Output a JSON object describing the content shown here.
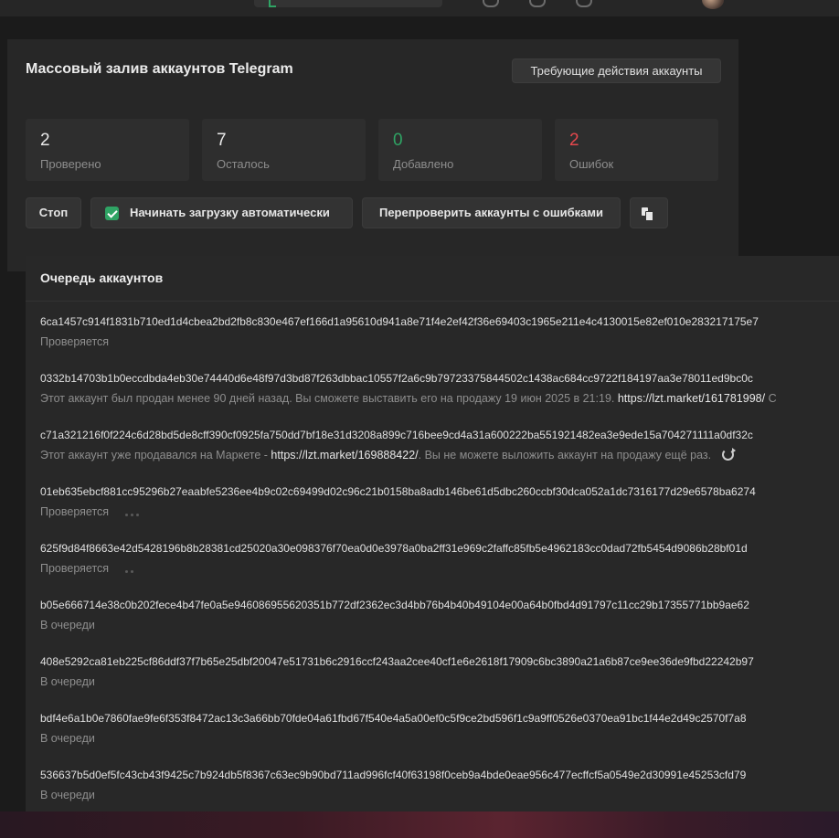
{
  "window": {
    "accent": "#2fa364",
    "error_color": "#e5484d"
  },
  "panel": {
    "title": "Массовый залив аккаунтов Telegram",
    "action_required_button": "Требующие действия аккаунты"
  },
  "stats": [
    {
      "value": "2",
      "label": "Проверено"
    },
    {
      "value": "7",
      "label": "Осталось"
    },
    {
      "value": "0",
      "label": "Добавлено"
    },
    {
      "value": "2",
      "label": "Ошибок"
    }
  ],
  "controls": {
    "stop": "Стоп",
    "auto_start": "Начинать загрузку автоматически",
    "auto_start_checked": true,
    "recheck": "Перепроверить аккаунты с ошибками",
    "copy_icon": "copy-icon"
  },
  "queue": {
    "title": "Очередь аккаунтов",
    "items": [
      {
        "hash": "6ca1457c914f1831b710ed1d4cbea2bd2fb8c830e467ef166d1a95610d941a8e71f4e2ef42f36e69403c1965e211e4c4130015e82ef010e283217175e7",
        "status": "Проверяется"
      },
      {
        "hash": "0332b14703b1b0eccdbda4eb30e74440d6e48f97d3bd87f263dbbac10557f2a6c9b79723375844502c1438ac684cc9722f184197aa3e78011ed9bc0c",
        "status": "Этот аккаунт был продан менее 90 дней назад. Вы сможете выставить его на продажу 19 июн 2025 в 21:19.",
        "link": "https://lzt.market/161781998/",
        "tail": "С"
      },
      {
        "hash": "c71a321216f0f224c6d28bd5de8cff390cf0925fa750dd7bf18e31d3208a899c716bee9cd4a31a600222ba551921482ea3e9ede15a704271111a0df32c",
        "status_pre": "Этот аккаунт уже продавался на Маркете -",
        "link": "https://lzt.market/169888422/",
        "status_post": ". Вы не можете выложить аккаунт на продажу ещё раз."
      },
      {
        "hash": "01eb635ebcf881cc95296b27eaabfe5236ee4b9c02c69499d02c96c21b0158ba8adb146be61d5dbc260ccbf30dca052a1dc7316177d29e6578ba6274",
        "status": "Проверяется"
      },
      {
        "hash": "625f9d84f8663e42d5428196b8b28381cd25020a30e098376f70ea0d0e3978a0ba2ff31e969c2faffc85fb5e4962183cc0dad72fb5454d9086b28bf01d",
        "status": "Проверяется"
      },
      {
        "hash": "b05e666714e38c0b202fece4b47fe0a5e946086955620351b772df2362ec3d4bb76b4b40b49104e00a64b0fbd4d91797c11cc29b17355771bb9ae62",
        "status": "В очереди"
      },
      {
        "hash": "408e5292ca81eb225cf86ddf37f7b65e25dbf20047e51731b6c2916ccf243aa2cee40cf1e6e2618f17909c6bc3890a21a6b87ce9ee36de9fbd22242b97",
        "status": "В очереди"
      },
      {
        "hash": "bdf4e6a1b0e7860fae9fe6f353f8472ac13c3a66bb70fde04a61fbd67f540e4a5a00ef0c5f9ce2bd596f1c9a9ff0526e0370ea91bc1f44e2d49c2570f7a8",
        "status": "В очереди"
      },
      {
        "hash": "536637b5d0ef5fc43cb43f9425c7b924db5f8367c63ec9b90bd711ad996fcf40f63198f0ceb9a4bde0eae956c477ecffcf5a0549e2d30991e45253cfd79",
        "status": "В очереди"
      }
    ]
  }
}
